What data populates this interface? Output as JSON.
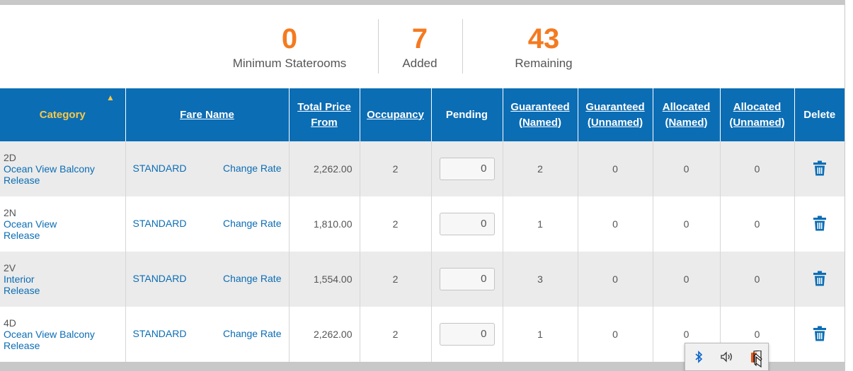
{
  "stats": {
    "minimum": {
      "value": "0",
      "label": "Minimum Staterooms"
    },
    "added": {
      "value": "7",
      "label": "Added"
    },
    "remaining": {
      "value": "43",
      "label": "Remaining"
    }
  },
  "table": {
    "headers": {
      "category": "Category",
      "fare_name": "Fare Name",
      "total_price_l1": "Total Price",
      "total_price_l2": "From",
      "occupancy": "Occupancy",
      "pending": "Pending",
      "gn_l1": "Guaranteed",
      "gn_l2": "(Named)",
      "gu_l1": "Guaranteed",
      "gu_l2": "(Unnamed)",
      "an_l1": "Allocated",
      "an_l2": "(Named)",
      "au_l1": "Allocated",
      "au_l2": "(Unnamed)",
      "delete": "Delete"
    },
    "rows": [
      {
        "code": "2D",
        "name": "Ocean View Balcony",
        "release": "Release",
        "fare": "STANDARD",
        "change": "Change Rate",
        "price": "2,262.00",
        "occupancy": "2",
        "pending": "0",
        "guaranteed_named": "2",
        "guaranteed_unnamed": "0",
        "allocated_named": "0",
        "allocated_unnamed": "0"
      },
      {
        "code": "2N",
        "name": "Ocean View",
        "release": "Release",
        "fare": "STANDARD",
        "change": "Change Rate",
        "price": "1,810.00",
        "occupancy": "2",
        "pending": "0",
        "guaranteed_named": "1",
        "guaranteed_unnamed": "0",
        "allocated_named": "0",
        "allocated_unnamed": "0"
      },
      {
        "code": "2V",
        "name": "Interior",
        "release": "Release",
        "fare": "STANDARD",
        "change": "Change Rate",
        "price": "1,554.00",
        "occupancy": "2",
        "pending": "0",
        "guaranteed_named": "3",
        "guaranteed_unnamed": "0",
        "allocated_named": "0",
        "allocated_unnamed": "0"
      },
      {
        "code": "4D",
        "name": "Ocean View Balcony",
        "release": "Release",
        "fare": "STANDARD",
        "change": "Change Rate",
        "price": "2,262.00",
        "occupancy": "2",
        "pending": "0",
        "guaranteed_named": "1",
        "guaranteed_unnamed": "0",
        "allocated_named": "0",
        "allocated_unnamed": "0"
      }
    ]
  },
  "colors": {
    "accent": "#f47a20",
    "header_bg": "#0b6db4",
    "sorted_header": "#f7c948",
    "link": "#0b6db4"
  },
  "icons": {
    "delete": "trash-icon",
    "tray": [
      "bluetooth-icon",
      "speaker-icon",
      "office-icon",
      "mouse-cursor-icon"
    ]
  }
}
